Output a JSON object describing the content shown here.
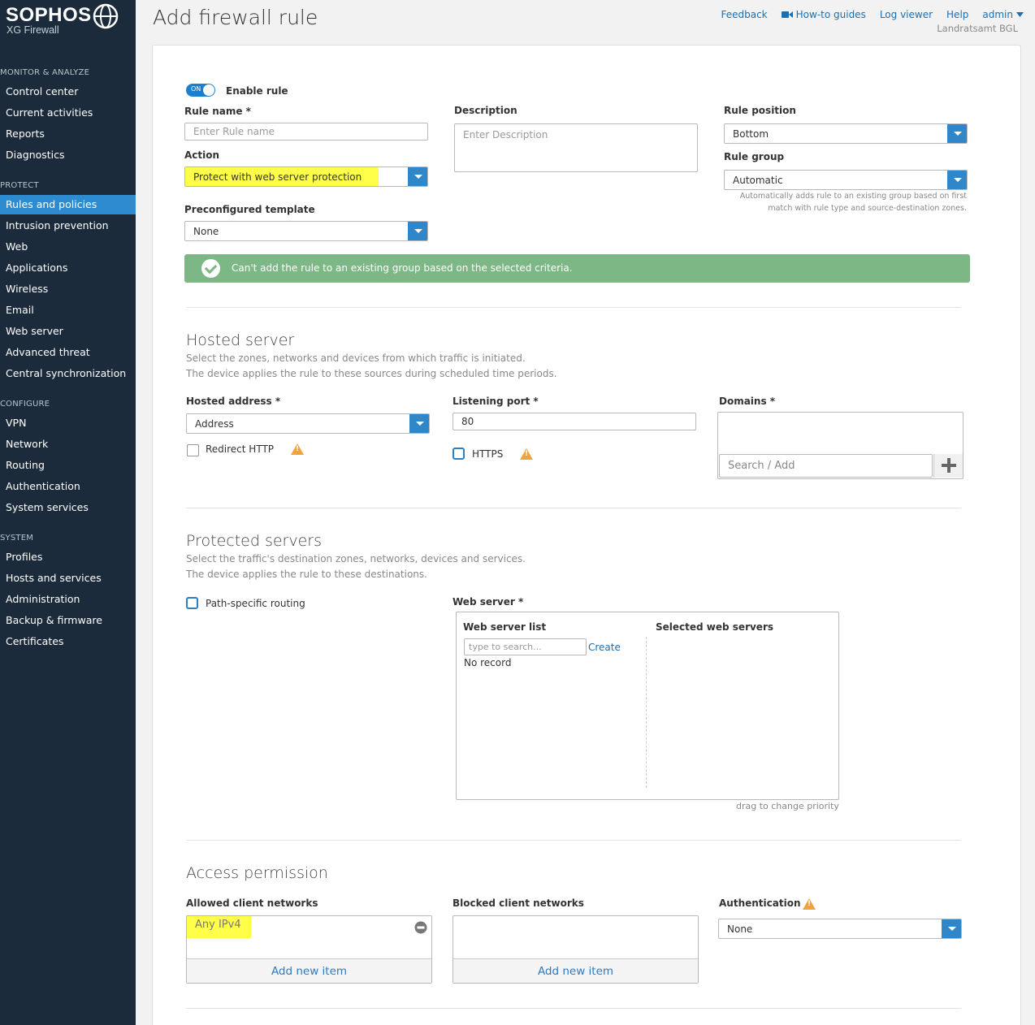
{
  "brand": {
    "name": "SOPHOS",
    "product": "XG Firewall"
  },
  "sidebar": {
    "sections": [
      {
        "title": "MONITOR & ANALYZE",
        "items": [
          "Control center",
          "Current activities",
          "Reports",
          "Diagnostics"
        ]
      },
      {
        "title": "PROTECT",
        "items": [
          "Rules and policies",
          "Intrusion prevention",
          "Web",
          "Applications",
          "Wireless",
          "Email",
          "Web server",
          "Advanced threat",
          "Central synchronization"
        ]
      },
      {
        "title": "CONFIGURE",
        "items": [
          "VPN",
          "Network",
          "Routing",
          "Authentication",
          "System services"
        ]
      },
      {
        "title": "SYSTEM",
        "items": [
          "Profiles",
          "Hosts and services",
          "Administration",
          "Backup & firmware",
          "Certificates"
        ]
      }
    ],
    "active_item": "Rules and policies"
  },
  "header": {
    "title": "Add firewall rule",
    "links": {
      "feedback": "Feedback",
      "howto": "How-to guides",
      "logviewer": "Log viewer",
      "help": "Help",
      "admin": "admin"
    },
    "tenant": "Landratsamt BGL"
  },
  "form": {
    "enable": {
      "toggle_text": "ON",
      "label": "Enable rule"
    },
    "rule_name": {
      "label": "Rule name *",
      "placeholder": "Enter Rule name"
    },
    "description": {
      "label": "Description",
      "placeholder": "Enter Description"
    },
    "rule_position": {
      "label": "Rule position",
      "value": "Bottom"
    },
    "action": {
      "label": "Action",
      "value": "Protect with web server protection"
    },
    "rule_group": {
      "label": "Rule group",
      "value": "Automatic",
      "hint_line1": "Automatically adds rule to an existing group based on first",
      "hint_line2": "match with rule type and source-destination zones."
    },
    "preconfigured_template": {
      "label": "Preconfigured template",
      "value": "None"
    },
    "banner": "Can't add the rule to an existing group based on the selected criteria."
  },
  "hosted_server": {
    "title": "Hosted server",
    "desc1": "Select the zones, networks and devices from which traffic is initiated.",
    "desc2": "The device applies the rule to these sources during scheduled time periods.",
    "hosted_address": {
      "label": "Hosted address *",
      "value": "Address"
    },
    "redirect_http": "Redirect HTTP",
    "listening_port": {
      "label": "Listening port *",
      "value": "80"
    },
    "https": "HTTPS",
    "domains": {
      "label": "Domains *",
      "placeholder": "Search / Add"
    }
  },
  "protected_servers": {
    "title": "Protected servers",
    "desc1": "Select the traffic's destination zones, networks, devices and services.",
    "desc2": "The device applies the rule to these destinations.",
    "path_specific": "Path-specific routing",
    "web_server": {
      "label": "Web server *",
      "list_title": "Web server list",
      "search_placeholder": "type to search...",
      "create": "Create",
      "no_record": "No record",
      "selected_title": "Selected web servers",
      "drag_hint": "drag to change priority"
    }
  },
  "access": {
    "title": "Access permission",
    "allowed": {
      "label": "Allowed client networks",
      "item": "Any IPv4",
      "add": "Add new item"
    },
    "blocked": {
      "label": "Blocked client networks",
      "add": "Add new item"
    },
    "authentication": {
      "label": "Authentication",
      "value": "None"
    }
  }
}
